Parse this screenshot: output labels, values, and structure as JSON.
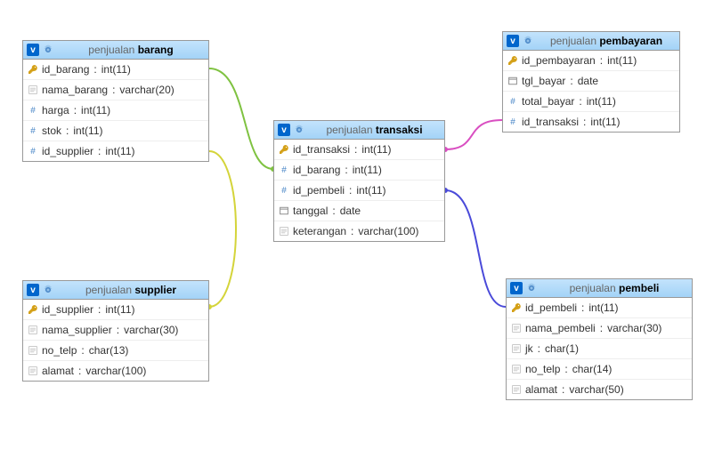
{
  "database": "penjualan",
  "tables": {
    "barang": {
      "title": "barang",
      "columns": [
        {
          "icon": "key",
          "name": "id_barang",
          "type": "int(11)"
        },
        {
          "icon": "text",
          "name": "nama_barang",
          "type": "varchar(20)"
        },
        {
          "icon": "hash",
          "name": "harga",
          "type": "int(11)"
        },
        {
          "icon": "hash",
          "name": "stok",
          "type": "int(11)"
        },
        {
          "icon": "hash",
          "name": "id_supplier",
          "type": "int(11)"
        }
      ]
    },
    "transaksi": {
      "title": "transaksi",
      "columns": [
        {
          "icon": "key",
          "name": "id_transaksi",
          "type": "int(11)"
        },
        {
          "icon": "hash",
          "name": "id_barang",
          "type": "int(11)"
        },
        {
          "icon": "hash",
          "name": "id_pembeli",
          "type": "int(11)"
        },
        {
          "icon": "date",
          "name": "tanggal",
          "type": "date"
        },
        {
          "icon": "text",
          "name": "keterangan",
          "type": "varchar(100)"
        }
      ]
    },
    "pembayaran": {
      "title": "pembayaran",
      "columns": [
        {
          "icon": "key",
          "name": "id_pembayaran",
          "type": "int(11)"
        },
        {
          "icon": "date",
          "name": "tgl_bayar",
          "type": "date"
        },
        {
          "icon": "hash",
          "name": "total_bayar",
          "type": "int(11)"
        },
        {
          "icon": "hash",
          "name": "id_transaksi",
          "type": "int(11)"
        }
      ]
    },
    "supplier": {
      "title": "supplier",
      "columns": [
        {
          "icon": "key",
          "name": "id_supplier",
          "type": "int(11)"
        },
        {
          "icon": "text",
          "name": "nama_supplier",
          "type": "varchar(30)"
        },
        {
          "icon": "text",
          "name": "no_telp",
          "type": "char(13)"
        },
        {
          "icon": "text",
          "name": "alamat",
          "type": "varchar(100)"
        }
      ]
    },
    "pembeli": {
      "title": "pembeli",
      "columns": [
        {
          "icon": "key",
          "name": "id_pembeli",
          "type": "int(11)"
        },
        {
          "icon": "text",
          "name": "nama_pembeli",
          "type": "varchar(30)"
        },
        {
          "icon": "text",
          "name": "jk",
          "type": "char(1)"
        },
        {
          "icon": "text",
          "name": "no_telp",
          "type": "char(14)"
        },
        {
          "icon": "text",
          "name": "alamat",
          "type": "varchar(50)"
        }
      ]
    }
  },
  "relations": [
    {
      "from": "barang.id_barang",
      "to": "transaksi.id_barang",
      "color": "#7fc241"
    },
    {
      "from": "barang.id_supplier",
      "to": "supplier.id_supplier",
      "color": "#d4d43a"
    },
    {
      "from": "transaksi.id_transaksi",
      "to": "pembayaran.id_transaksi",
      "color": "#d94ec1"
    },
    {
      "from": "transaksi.id_pembeli",
      "to": "pembeli.id_pembeli",
      "color": "#4a4ad9"
    }
  ]
}
